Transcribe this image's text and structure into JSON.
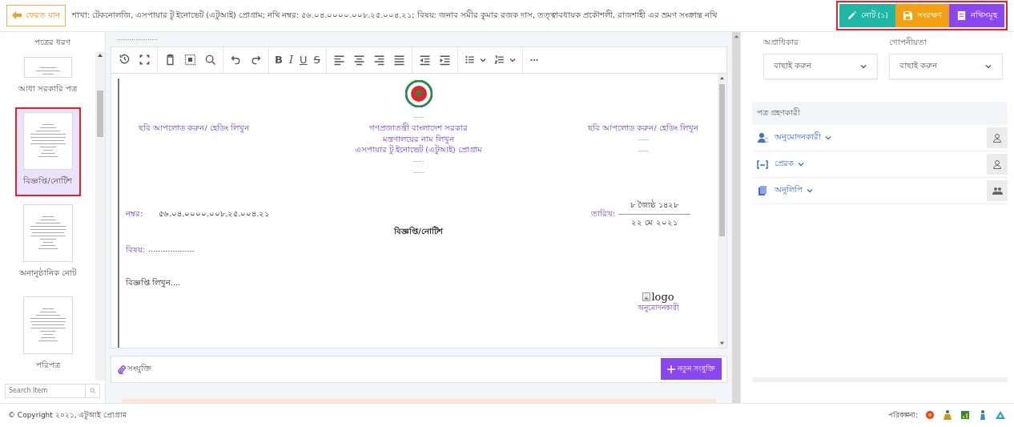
{
  "header": {
    "back_button": "ফেরত যান",
    "file_info": "শাখা: টেকনোলজি, এসপায়ার টু ইনোভেট (এটুআই) প্রোগ্রাম; নথি নম্বর: ৫৬.০৪.০০০০.০০৮.২৫.০০৪.২১; বিষয়: জনাব সমীর কুমার রজক দাস, তত্ত্বাবধায়ক প্রকৌশলী, রাজশাহী এর ভ্রমণ সংক্রান্ত নথি",
    "buttons": [
      {
        "kind": "note",
        "label": "নোট (১)"
      },
      {
        "kind": "save",
        "label": "সংরক্ষণ"
      },
      {
        "kind": "files",
        "label": "নথিসমূহ"
      }
    ]
  },
  "sidebar": {
    "title": "পত্রের ধরণ",
    "items": [
      {
        "label": "আধা সরকারি পত্র",
        "selected": false
      },
      {
        "label": "বিজ্ঞপ্তি/নোটিশ",
        "selected": true
      },
      {
        "label": "অনানুষ্ঠানিক নোট",
        "selected": false
      },
      {
        "label": "পরিপত্র",
        "selected": false
      }
    ],
    "search": {
      "placeholder": "Search Item"
    }
  },
  "editor": {
    "top_line": "....................",
    "toolbar": [
      {
        "kind": "history"
      },
      {
        "kind": "fullscreen"
      },
      {
        "kind": "paste"
      },
      {
        "kind": "select-all"
      },
      {
        "kind": "search"
      },
      {
        "kind": "undo"
      },
      {
        "kind": "redo"
      },
      {
        "kind": "bold",
        "label": "B"
      },
      {
        "kind": "italic",
        "label": "I"
      },
      {
        "kind": "underline",
        "label": "U"
      },
      {
        "kind": "strike",
        "label": "S"
      },
      {
        "kind": "align-left"
      },
      {
        "kind": "align-center"
      },
      {
        "kind": "align-right"
      },
      {
        "kind": "justify"
      },
      {
        "kind": "outdent"
      },
      {
        "kind": "indent"
      },
      {
        "kind": "bullets"
      },
      {
        "kind": "numbers"
      },
      {
        "kind": "more"
      }
    ],
    "document": {
      "heading_left": "ছবি আপলোড করুন/ হেডিং লিখুন",
      "center_lines": [
        "----",
        "গণপ্রজাতন্ত্রী বাংলাদেশ সরকার",
        "মন্ত্রণালয়ের নাম লিখুন",
        "এসপায়ার টু ইনোভেট (এটুআই) প্রোগ্রাম",
        "----",
        "----"
      ],
      "heading_right": "ছবি আপলোড করুন/ হেডিং লিখুন",
      "right_lines": [
        "----",
        "----"
      ],
      "number_label": "নম্বর:",
      "number": "৫৬.০৪.০০০০.০০৮.২৫.০০৪.২১",
      "date_label": "তারিখ:",
      "date_bangla": "৮ জ্যৈষ্ঠ ১৪২৮",
      "date_english": "২২ মে ২০২১",
      "title": "বিজ্ঞপ্তি/নোটিশ",
      "subject_label": "বিষয়:",
      "subject": "...................",
      "body": "বিজ্ঞপ্তি লিখুন....",
      "logo_alt": "logo",
      "signer": "অনুমোদনকারী"
    },
    "attachments": {
      "label": "সংযুক্তি",
      "button": "নতুন সংযুক্তি"
    }
  },
  "details": {
    "fields": [
      {
        "label": "অগ্রাধিকার",
        "value": "বাছাই করুন"
      },
      {
        "label": "গোপনীয়তা",
        "value": "বাছাই করুন"
      }
    ],
    "recipients": {
      "title": "পত্র গ্রহণকারী",
      "rows": [
        {
          "kind": "approver",
          "label": "অনুমোদনকারী"
        },
        {
          "kind": "sender",
          "label": "প্রেরক"
        },
        {
          "kind": "copy",
          "label": "অনুলিপি"
        }
      ]
    }
  },
  "footer": {
    "copyright": "© Copyright ২০২১, এটুআই প্রোগ্রাম",
    "credit_label": "পরিকল্পনা:"
  }
}
